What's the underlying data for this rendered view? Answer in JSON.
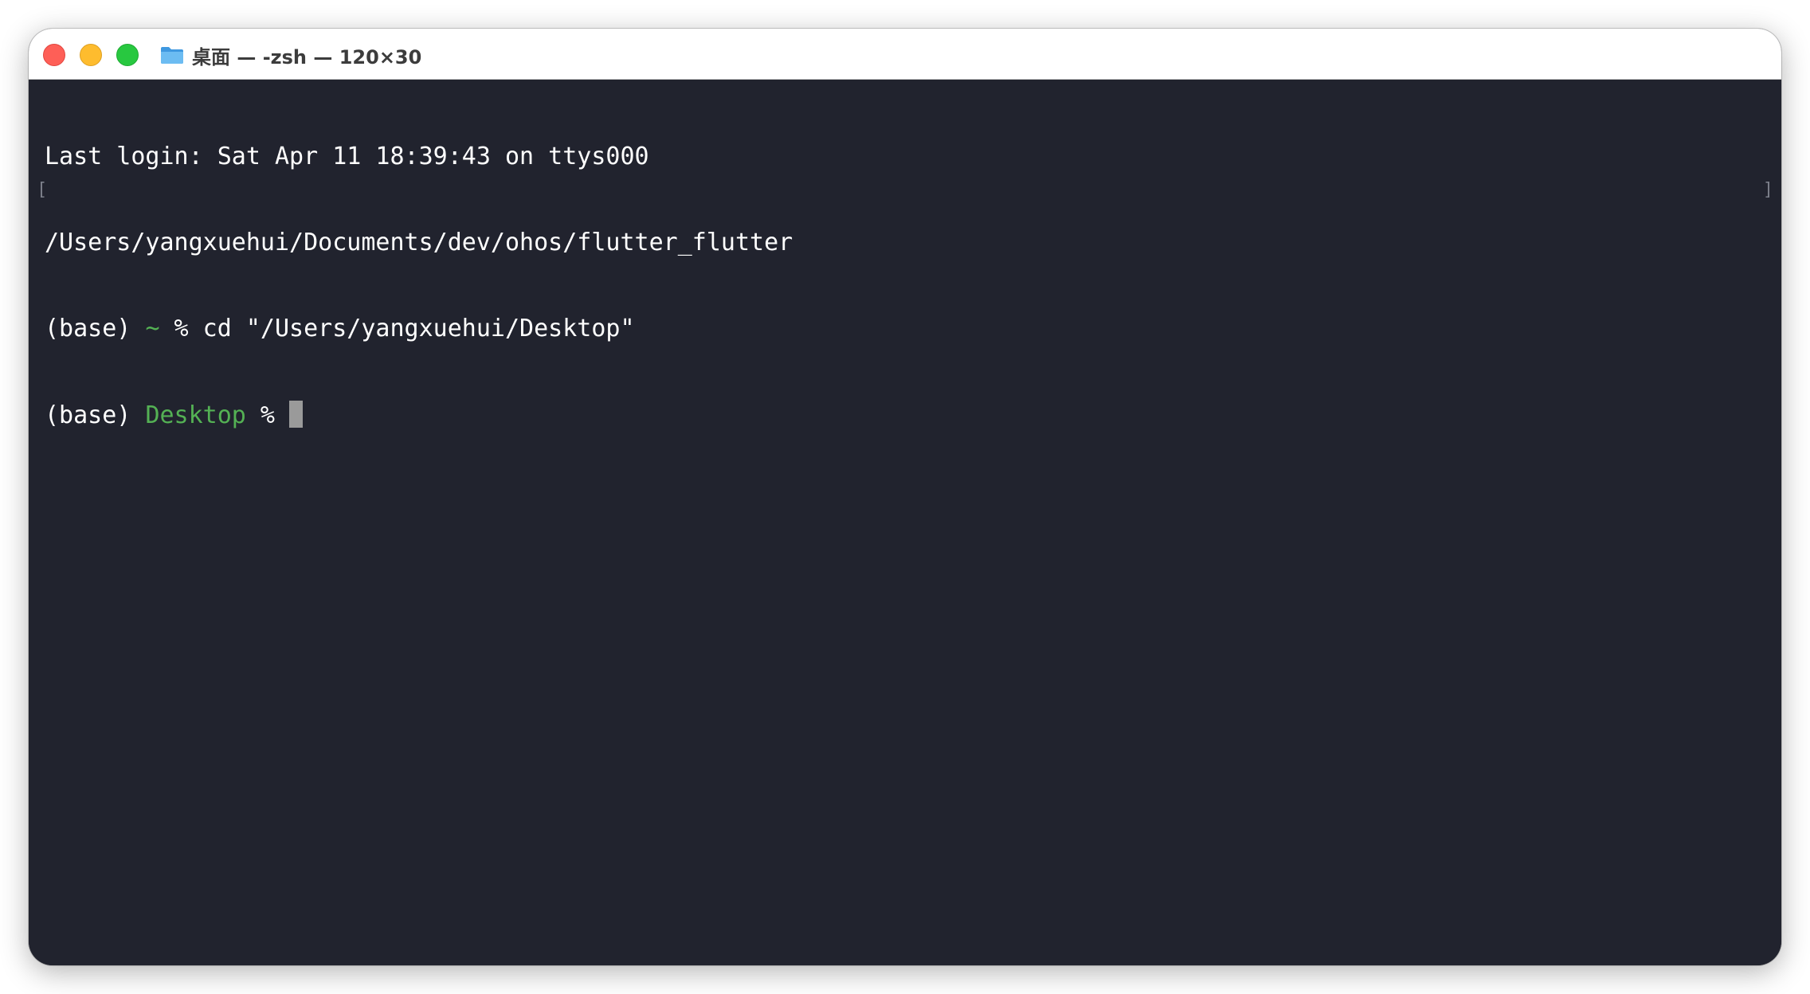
{
  "window": {
    "title": "桌面 — -zsh — 120×30"
  },
  "terminal": {
    "lines": [
      {
        "text": "Last login: Sat Apr 11 18:39:43 on ttys000"
      },
      {
        "text": "/Users/yangxuehui/Documents/dev/ohos/flutter_flutter"
      },
      {
        "prefix": "(base) ",
        "dir": "~",
        "suffix": " % cd \"/Users/yangxuehui/Desktop\""
      },
      {
        "prefix": "(base) ",
        "dir": "Desktop",
        "suffix": " % "
      }
    ],
    "mark_left": "[",
    "mark_right": "]"
  },
  "colors": {
    "background": "#21232e",
    "text": "#ffffff",
    "prompt_dir": "#54b154",
    "cursor": "#9a9a9a",
    "close": "#fe5f57",
    "minimize": "#febc2e",
    "zoom": "#28c840"
  },
  "icons": {
    "title": "folder-icon"
  }
}
